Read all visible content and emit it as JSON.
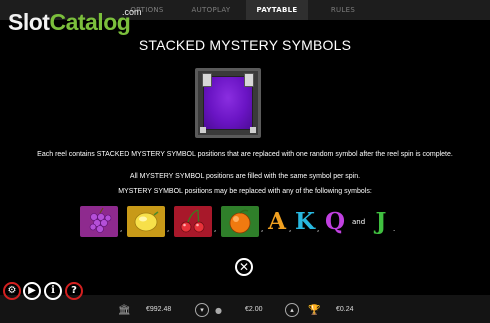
{
  "tabs": [
    {
      "label": "OPTIONS"
    },
    {
      "label": "AUTOPLAY"
    },
    {
      "label": "PAYTABLE"
    },
    {
      "label": "RULES"
    }
  ],
  "active_tab": "PAYTABLE",
  "watermark": {
    "part1": "Slot",
    "part2": "Catalog",
    "suffix": ".com"
  },
  "paytable": {
    "title": "STACKED MYSTERY SYMBOLS",
    "paragraph1": "Each reel contains STACKED MYSTERY SYMBOL positions that are replaced with one random symbol after the reel spin is complete.",
    "paragraph2": "All MYSTERY SYMBOL positions are filled with the same symbol per spin.",
    "paragraph3": "MYSTERY SYMBOL positions may be replaced with any of the following symbols:",
    "symbols": [
      {
        "name": "grapes",
        "icon": "grapes-icon",
        "color": "#8e2a8e"
      },
      {
        "name": "lemon",
        "icon": "lemon-icon",
        "color": "#c89a18"
      },
      {
        "name": "cherries",
        "icon": "cherries-icon",
        "color": "#a8182a"
      },
      {
        "name": "orange",
        "icon": "orange-icon",
        "color": "#2f7f2a"
      }
    ],
    "letters": [
      {
        "char": "A",
        "color": "#f0a020"
      },
      {
        "char": "K",
        "color": "#28b8e0"
      },
      {
        "char": "Q",
        "color": "#c040e0"
      },
      {
        "char": "J",
        "color": "#40c040"
      }
    ],
    "separator": ",",
    "and_text": "and",
    "end": "."
  },
  "bottom_bar": {
    "balance": "€992.48",
    "bet": "€2.00",
    "win": "€0.24"
  }
}
